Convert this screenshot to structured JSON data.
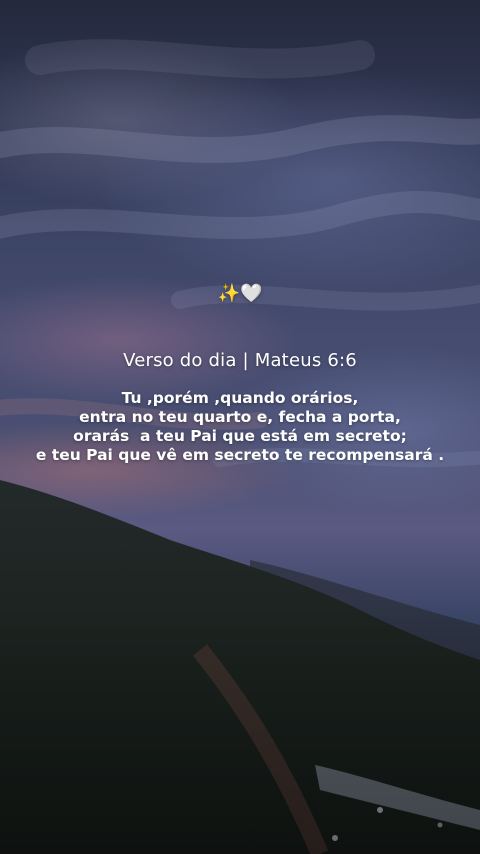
{
  "decoration": {
    "sparkles": "✨",
    "heart": "🤍"
  },
  "title": "Verso do dia | Mateus 6:6",
  "verse_lines": [
    "Tu ,porém ,quando orários,",
    "entra no teu quarto e, fecha a porta,",
    "orarás  a teu Pai que está em secreto;",
    "e teu Pai que vê em secreto te recompensará ."
  ],
  "colors": {
    "text": "#ffffff",
    "sky_top": "#2a3048",
    "sky_mid": "#4a4f72",
    "hill": "#1a1f1c"
  }
}
